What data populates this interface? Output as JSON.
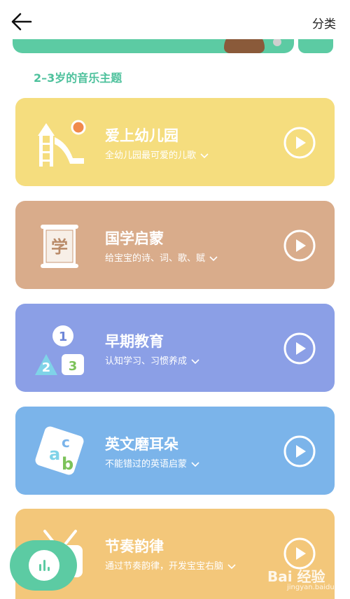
{
  "header": {
    "back_icon": "arrow-left-icon",
    "category_label": "分类"
  },
  "section": {
    "title": "2–3岁的音乐主题"
  },
  "cards": [
    {
      "title": "爱上幼儿园",
      "subtitle": "全幼儿园最可爱的儿歌",
      "color": "#f5dd7e",
      "icon": "slide-icon"
    },
    {
      "title": "国学启蒙",
      "subtitle": "给宝宝的诗、词、歌、赋",
      "color": "#d9ac8b",
      "icon": "scroll-icon"
    },
    {
      "title": "早期教育",
      "subtitle": "认知学习、习惯养成",
      "color": "#8b9fe6",
      "icon": "number-blocks-icon"
    },
    {
      "title": "英文磨耳朵",
      "subtitle": "不能错过的英语启蒙",
      "color": "#7bb4ea",
      "icon": "abc-block-icon"
    },
    {
      "title": "节奏韵律",
      "subtitle": "通过节奏韵律，开发宝宝右脑",
      "color": "#f3c77a",
      "icon": "tv-icon"
    }
  ],
  "fab": {
    "icon": "equalizer-icon"
  },
  "watermark": {
    "brand": "Bai  经验",
    "url": "jingyan.baidu.com"
  },
  "colors": {
    "accent": "#5ccba3",
    "section_title": "#4dc19c"
  }
}
